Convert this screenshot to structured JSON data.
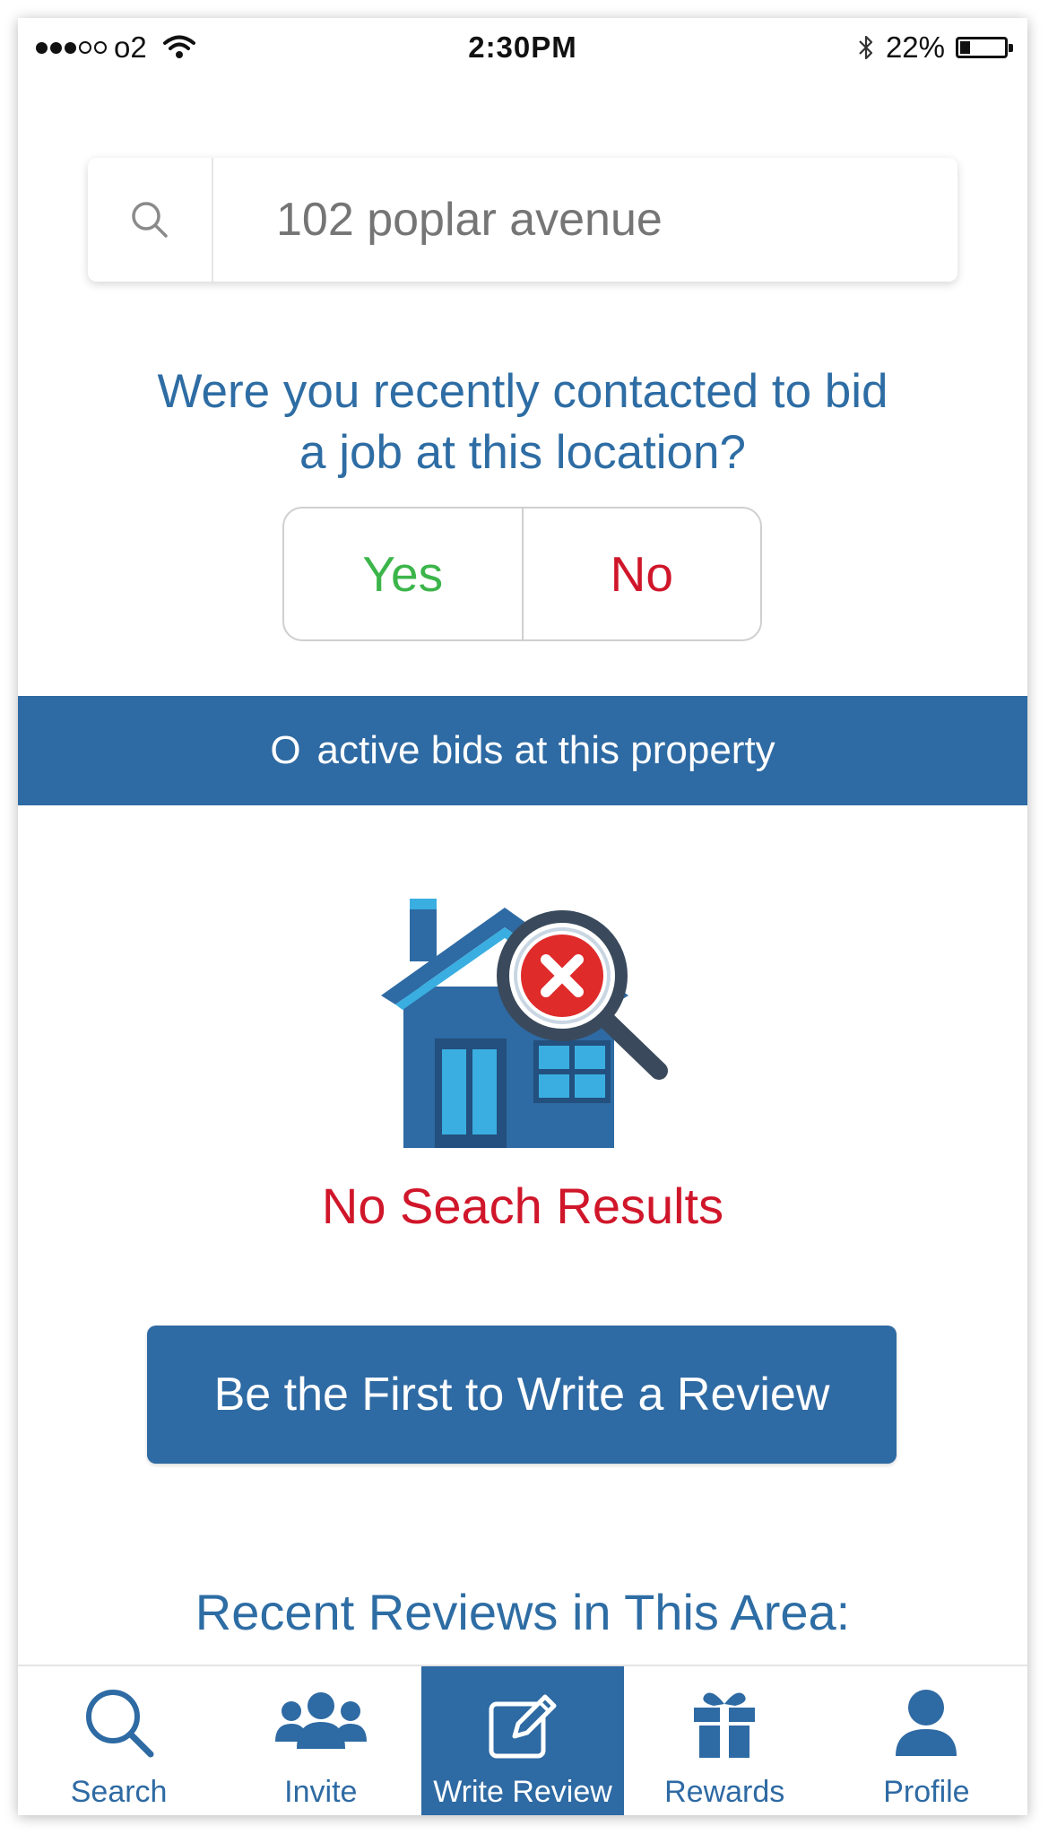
{
  "status_bar": {
    "carrier": "o2",
    "time": "2:30PM",
    "battery_percent": "22%",
    "battery_level": 0.22
  },
  "search": {
    "placeholder": "102 poplar avenue",
    "icon": "search-icon"
  },
  "question": {
    "line1": "Were you recently contacted to bid",
    "line2": "a job at this location?"
  },
  "toggle": {
    "yes_label": "Yes",
    "no_label": "No",
    "yes_color": "#3cb54a",
    "no_color": "#d0162a"
  },
  "bids_banner": {
    "count": "O",
    "text": "active bids at this property"
  },
  "illustration": {
    "icon": "house-no-results-icon"
  },
  "no_results_text": "No Seach Results",
  "review_button_label": "Be the First to Write a Review",
  "recent_heading": "Recent Reviews in This Area:",
  "tab_bar": {
    "tabs": [
      {
        "label": "Search",
        "icon": "search-icon",
        "active": false
      },
      {
        "label": "Invite",
        "icon": "people-icon",
        "active": false
      },
      {
        "label": "Write Review",
        "icon": "edit-icon",
        "active": true
      },
      {
        "label": "Rewards",
        "icon": "gift-icon",
        "active": false
      },
      {
        "label": "Profile",
        "icon": "person-icon",
        "active": false
      }
    ]
  },
  "colors": {
    "brand_blue": "#2e6aa3",
    "error_red": "#d0162a",
    "success_green": "#3cb54a"
  }
}
